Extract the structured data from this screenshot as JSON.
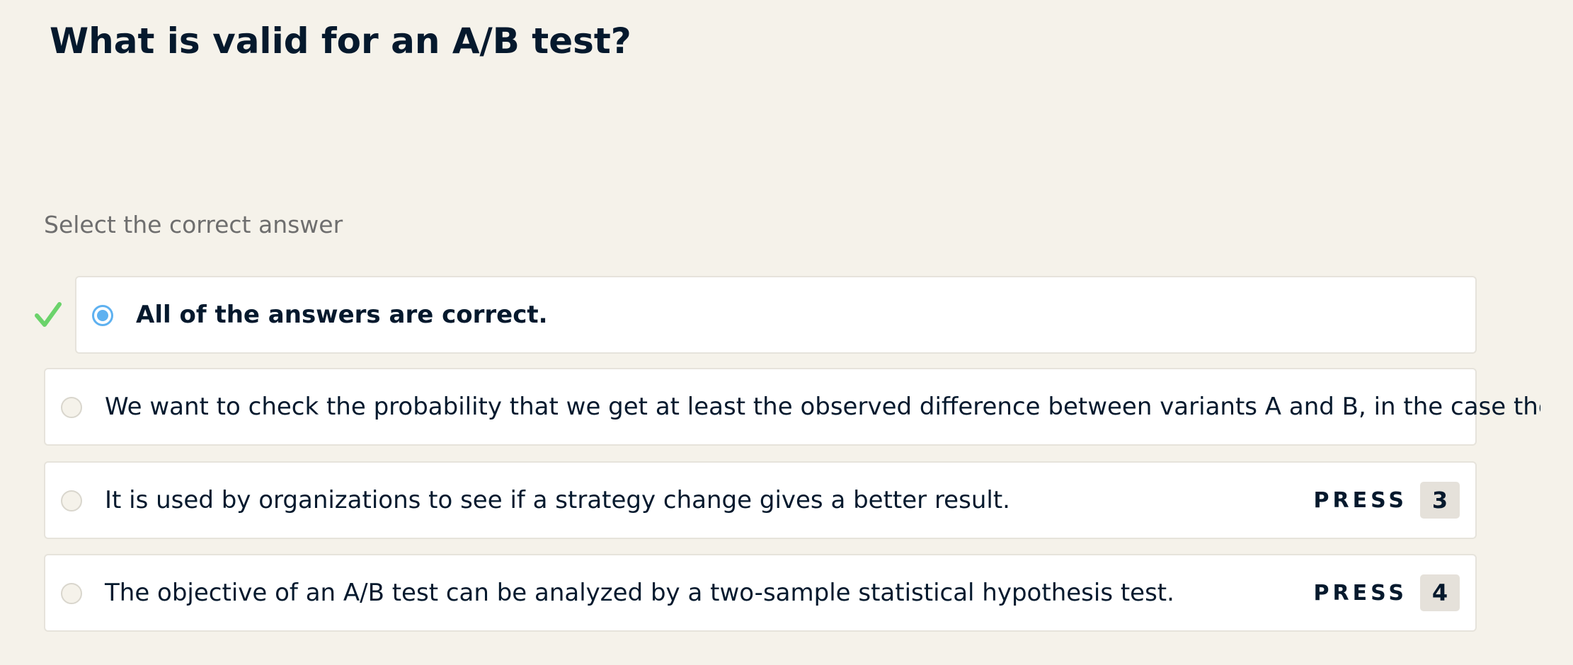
{
  "question": {
    "title": "What is valid for an A/B test?"
  },
  "instruction": "Select the correct answer",
  "colors": {
    "background": "#f5f2ea",
    "text": "#05192d",
    "selected_radio": "#5eb1f0",
    "correct_check": "#6bd36b",
    "key_badge": "#e5e1da"
  },
  "options": [
    {
      "text": "All of the answers are correct.",
      "selected": true,
      "marked_correct": true
    },
    {
      "text": "We want to check the probability that we get at least the observed difference between variants A and B, in the case the str",
      "selected": false
    },
    {
      "text": "It is used by organizations to see if a strategy change gives a better result.",
      "selected": false,
      "shortcut_label": "PRESS",
      "shortcut_key": "3"
    },
    {
      "text": "The objective of an A/B test can be analyzed by a two-sample statistical hypothesis test.",
      "selected": false,
      "shortcut_label": "PRESS",
      "shortcut_key": "4"
    }
  ],
  "icons": {
    "correct": "checkmark-icon"
  }
}
